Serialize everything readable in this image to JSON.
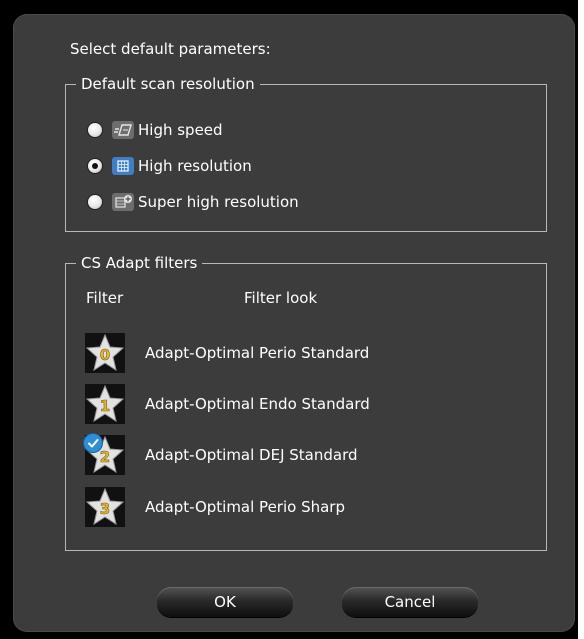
{
  "dialog": {
    "heading": "Select default parameters:"
  },
  "scan_resolution": {
    "legend": "Default scan resolution",
    "options": [
      {
        "label": "High speed",
        "icon": "high-speed-icon",
        "checked": false
      },
      {
        "label": "High resolution",
        "icon": "high-resolution-icon",
        "checked": true
      },
      {
        "label": "Super high resolution",
        "icon": "super-high-resolution-icon",
        "checked": false
      }
    ]
  },
  "filters": {
    "legend": "CS Adapt filters",
    "col_filter": "Filter",
    "col_look": "Filter look",
    "items": [
      {
        "number": "0",
        "label": "Adapt-Optimal Perio Standard",
        "selected": false
      },
      {
        "number": "1",
        "label": "Adapt-Optimal Endo Standard",
        "selected": false
      },
      {
        "number": "2",
        "label": "Adapt-Optimal DEJ Standard",
        "selected": true
      },
      {
        "number": "3",
        "label": "Adapt-Optimal Perio Sharp",
        "selected": false
      }
    ]
  },
  "buttons": {
    "ok": "OK",
    "cancel": "Cancel"
  },
  "colors": {
    "dialog_bg": "#3c3c3c",
    "star_gold": "#e0b93a",
    "star_silver": "#d8d8d8",
    "check_blue": "#2f8fd6"
  }
}
